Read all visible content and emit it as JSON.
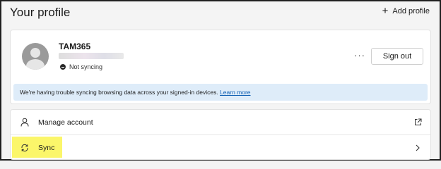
{
  "header": {
    "title": "Your profile",
    "add_profile_label": "Add profile"
  },
  "profile": {
    "name": "TAM365",
    "sync_status": "Not syncing",
    "more_label": "···",
    "sign_out_label": "Sign out",
    "notice_text": "We're having trouble syncing browsing data across your signed-in devices. ",
    "notice_link": "Learn more"
  },
  "settings_list": {
    "items": [
      {
        "label": "Manage account",
        "icon": "person-icon",
        "trail_icon": "open-external-icon"
      },
      {
        "label": "Sync",
        "icon": "sync-icon",
        "trail_icon": "chevron-right-icon",
        "highlight_color": "#fbf66a"
      }
    ]
  },
  "colors": {
    "notice_bg": "#deecf9",
    "link": "#0f5fb3",
    "highlight": "#fbf66a"
  }
}
